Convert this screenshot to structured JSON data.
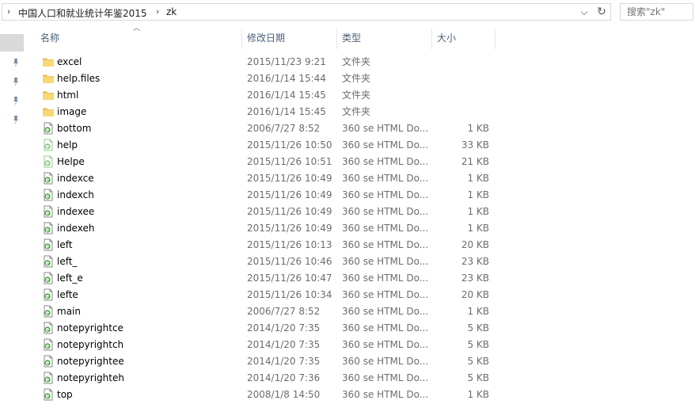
{
  "address": {
    "path": [
      "中国人口和就业统计年鉴2015",
      "zk"
    ],
    "dropdown_glyph": "⌵",
    "refresh_glyph": "↻"
  },
  "search": {
    "placeholder": "搜索\"zk\""
  },
  "columns": {
    "name": "名称",
    "date": "修改日期",
    "type": "类型",
    "size": "大小"
  },
  "icons": {
    "folder": "folder-icon",
    "html": "html-file-icon",
    "pin": "pin-icon"
  },
  "colors": {
    "folder": "#f8d775",
    "folder_dark": "#e4b84a",
    "html_e": "#3aa32f",
    "header_text": "#4c607a"
  },
  "files": [
    {
      "name": "excel",
      "date": "2015/11/23 9:21",
      "type": "文件夹",
      "size": "",
      "kind": "folder"
    },
    {
      "name": "help.files",
      "date": "2016/1/14 15:44",
      "type": "文件夹",
      "size": "",
      "kind": "folder"
    },
    {
      "name": "html",
      "date": "2016/1/14 15:45",
      "type": "文件夹",
      "size": "",
      "kind": "folder"
    },
    {
      "name": "image",
      "date": "2016/1/14 15:45",
      "type": "文件夹",
      "size": "",
      "kind": "folder"
    },
    {
      "name": "bottom",
      "date": "2006/7/27 8:52",
      "type": "360 se HTML Do...",
      "size": "1 KB",
      "kind": "html"
    },
    {
      "name": "help",
      "date": "2015/11/26 10:50",
      "type": "360 se HTML Do...",
      "size": "33 KB",
      "kind": "html-light"
    },
    {
      "name": "Helpe",
      "date": "2015/11/26 10:51",
      "type": "360 se HTML Do...",
      "size": "21 KB",
      "kind": "html-light"
    },
    {
      "name": "indexce",
      "date": "2015/11/26 10:49",
      "type": "360 se HTML Do...",
      "size": "1 KB",
      "kind": "html"
    },
    {
      "name": "indexch",
      "date": "2015/11/26 10:49",
      "type": "360 se HTML Do...",
      "size": "1 KB",
      "kind": "html"
    },
    {
      "name": "indexee",
      "date": "2015/11/26 10:49",
      "type": "360 se HTML Do...",
      "size": "1 KB",
      "kind": "html"
    },
    {
      "name": "indexeh",
      "date": "2015/11/26 10:49",
      "type": "360 se HTML Do...",
      "size": "1 KB",
      "kind": "html"
    },
    {
      "name": "left",
      "date": "2015/11/26 10:13",
      "type": "360 se HTML Do...",
      "size": "20 KB",
      "kind": "html"
    },
    {
      "name": "left_",
      "date": "2015/11/26 10:46",
      "type": "360 se HTML Do...",
      "size": "23 KB",
      "kind": "html"
    },
    {
      "name": "left_e",
      "date": "2015/11/26 10:47",
      "type": "360 se HTML Do...",
      "size": "23 KB",
      "kind": "html"
    },
    {
      "name": "lefte",
      "date": "2015/11/26 10:34",
      "type": "360 se HTML Do...",
      "size": "20 KB",
      "kind": "html"
    },
    {
      "name": "main",
      "date": "2006/7/27 8:52",
      "type": "360 se HTML Do...",
      "size": "1 KB",
      "kind": "html"
    },
    {
      "name": "notepyrightce",
      "date": "2014/1/20 7:35",
      "type": "360 se HTML Do...",
      "size": "5 KB",
      "kind": "html"
    },
    {
      "name": "notepyrightch",
      "date": "2014/1/20 7:35",
      "type": "360 se HTML Do...",
      "size": "5 KB",
      "kind": "html"
    },
    {
      "name": "notepyrightee",
      "date": "2014/1/20 7:35",
      "type": "360 se HTML Do...",
      "size": "5 KB",
      "kind": "html"
    },
    {
      "name": "notepyrighteh",
      "date": "2014/1/20 7:36",
      "type": "360 se HTML Do...",
      "size": "5 KB",
      "kind": "html"
    },
    {
      "name": "top",
      "date": "2008/1/8 14:50",
      "type": "360 se HTML Do...",
      "size": "1 KB",
      "kind": "html"
    }
  ]
}
